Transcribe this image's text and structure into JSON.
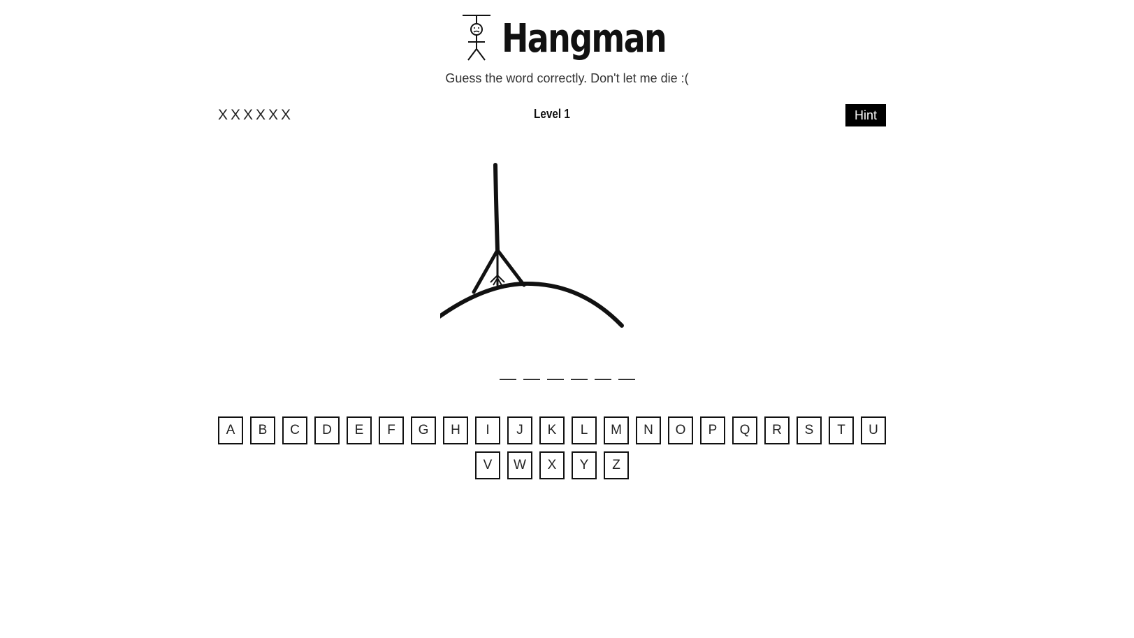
{
  "header": {
    "title": "Hangman",
    "subtitle": "Guess the word correctly. Don't let me die :(",
    "logo_icon": "hangman-stickfigure-icon"
  },
  "status": {
    "lives": "XXXXXX",
    "level": "Level 1",
    "hint_label": "Hint"
  },
  "word": {
    "length": 6
  },
  "keyboard": {
    "letters": [
      "A",
      "B",
      "C",
      "D",
      "E",
      "F",
      "G",
      "H",
      "I",
      "J",
      "K",
      "L",
      "M",
      "N",
      "O",
      "P",
      "Q",
      "R",
      "S",
      "T",
      "U",
      "V",
      "W",
      "X",
      "Y",
      "Z"
    ]
  },
  "colors": {
    "background": "#ffffff",
    "ink": "#111111",
    "hint_bg": "#000000",
    "hint_text": "#ffffff"
  }
}
